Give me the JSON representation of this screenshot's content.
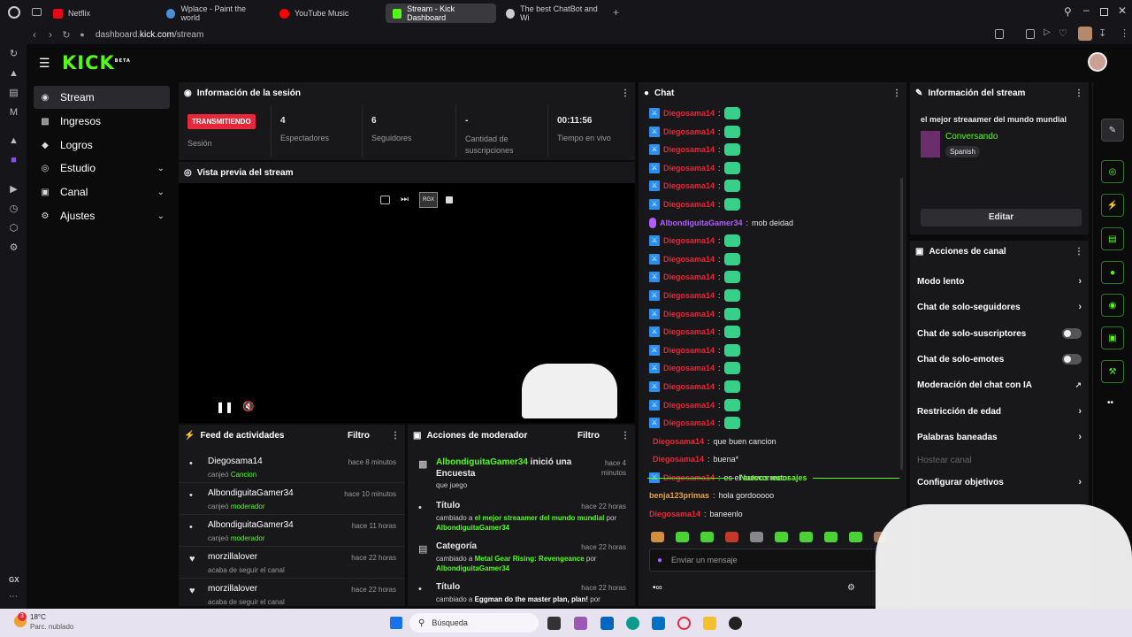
{
  "browser": {
    "tabs": [
      {
        "label": "Netflix",
        "color": "#e50914"
      },
      {
        "label": "Wplace - Paint the world",
        "color": "#4a90d9"
      },
      {
        "label": "YouTube Music",
        "color": "#ff0000"
      },
      {
        "label": "Stream - Kick Dashboard",
        "color": "#53fc18"
      },
      {
        "label": "The best ChatBot and Wi",
        "color": "#cccccc"
      }
    ],
    "url_prefix": "dashboard.",
    "url_domain": "kick.com",
    "url_path": "/stream"
  },
  "app": {
    "logo": "KICK",
    "logo_sup": "BETA"
  },
  "nav": {
    "items": [
      {
        "label": "Stream",
        "icon": "stream-icon"
      },
      {
        "label": "Ingresos",
        "icon": "chart-icon"
      },
      {
        "label": "Logros",
        "icon": "trophy-icon"
      },
      {
        "label": "Estudio",
        "icon": "studio-icon"
      },
      {
        "label": "Canal",
        "icon": "channel-icon"
      },
      {
        "label": "Ajustes",
        "icon": "gear-icon"
      }
    ]
  },
  "session": {
    "title": "Información de la sesión",
    "live_badge": "TRANSMITIENDO",
    "live_label": "Sesión",
    "stats": [
      {
        "value": "4",
        "label": "Espectadores"
      },
      {
        "value": "6",
        "label": "Seguidores"
      },
      {
        "value": "-",
        "label": "Cantidad de suscripciones"
      },
      {
        "value": "00:11:56",
        "label": "Tiempo en vivo"
      }
    ]
  },
  "preview": {
    "title": "Vista previa del stream",
    "rgx": "RGX"
  },
  "feed": {
    "title": "Feed de actividades",
    "filter": "Filtro",
    "items": [
      {
        "user": "Diegosama14",
        "time": "hace 8 minutos",
        "action": "canjeó",
        "target": "Cancion"
      },
      {
        "user": "AlbondiguitaGamer34",
        "time": "hace 10 minutos",
        "action": "canjeó",
        "target": "moderador"
      },
      {
        "user": "AlbondiguitaGamer34",
        "time": "hace 11 horas",
        "action": "canjeó",
        "target": "moderador"
      },
      {
        "user": "morzillalover",
        "time": "hace 22 horas",
        "action": "acaba de seguir el canal",
        "target": ""
      },
      {
        "user": "morzillalover",
        "time": "hace 22 horas",
        "action": "acaba de seguir el canal",
        "target": ""
      }
    ]
  },
  "modactions": {
    "title": "Acciones de moderador",
    "filter": "Filtro",
    "items": [
      {
        "head_user": "AlbondiguitaGamer34",
        "head_rest": " inició una",
        "head2": "Encuesta",
        "time": "hace 4 minutos",
        "line1": "que juego",
        "line1_green": "",
        "line2": ""
      },
      {
        "head_user": "",
        "head_rest": "Título",
        "head2": "",
        "time": "hace 22 horas",
        "line1": "cambiado a ",
        "line1_green": "el mejor streaamer del mundo mundial",
        "line1_after": " por",
        "line2": "AlbondiguitaGamer34"
      },
      {
        "head_user": "",
        "head_rest": "Categoría",
        "head2": "",
        "time": "hace 22 horas",
        "line1": "cambiado a ",
        "line1_green": "Metal Gear Rising: Revengeance",
        "line1_after": " por",
        "line2": "AlbondiguitaGamer34"
      },
      {
        "head_user": "",
        "head_rest": "Título",
        "head2": "",
        "time": "hace 22 horas",
        "line1": "cambiado a ",
        "line1_green": "Eggman do the master plan, plan!",
        "line1_after": " por",
        "line2": ""
      }
    ]
  },
  "chat": {
    "title": "Chat",
    "messages": [
      {
        "user": "Diegosama14",
        "text": "",
        "emote": true,
        "badge": "mod"
      },
      {
        "user": "Diegosama14",
        "text": "",
        "emote": true,
        "badge": "mod"
      },
      {
        "user": "Diegosama14",
        "text": "",
        "emote": true,
        "badge": "mod"
      },
      {
        "user": "Diegosama14",
        "text": "",
        "emote": true,
        "badge": "mod"
      },
      {
        "user": "Diegosama14",
        "text": "",
        "emote": true,
        "badge": "mod"
      },
      {
        "user": "Diegosama14",
        "text": "",
        "emote": true,
        "badge": "mod"
      },
      {
        "user": "AlbondiguitaGamer34",
        "text": "mob deidad",
        "emote": false,
        "badge": "mic"
      },
      {
        "user": "Diegosama14",
        "text": "",
        "emote": true,
        "badge": "mod"
      },
      {
        "user": "Diegosama14",
        "text": "",
        "emote": true,
        "badge": "mod"
      },
      {
        "user": "Diegosama14",
        "text": "",
        "emote": true,
        "badge": "mod"
      },
      {
        "user": "Diegosama14",
        "text": "",
        "emote": true,
        "badge": "mod"
      },
      {
        "user": "Diegosama14",
        "text": "",
        "emote": true,
        "badge": "mod"
      },
      {
        "user": "Diegosama14",
        "text": "",
        "emote": true,
        "badge": "mod"
      },
      {
        "user": "Diegosama14",
        "text": "",
        "emote": true,
        "badge": "mod"
      },
      {
        "user": "Diegosama14",
        "text": "",
        "emote": true,
        "badge": "mod"
      },
      {
        "user": "Diegosama14",
        "text": "",
        "emote": true,
        "badge": "mod"
      },
      {
        "user": "Diegosama14",
        "text": "",
        "emote": true,
        "badge": "mod"
      },
      {
        "user": "Diegosama14",
        "text": "",
        "emote": true,
        "badge": "mod"
      },
      {
        "user": "Diegosama14",
        "text": "que buen cancion",
        "emote": false,
        "badge": "none"
      },
      {
        "user": "Diegosama14",
        "text": "buena*",
        "emote": false,
        "badge": "none"
      },
      {
        "user": "Diegosama14",
        "text": "es el autocorrector",
        "emote": false,
        "badge": "mod"
      }
    ],
    "new_messages": "Nuevos mensajes",
    "after": [
      {
        "user": "benja123primas",
        "text": "hola gordooooo",
        "color": "#e8a33c"
      },
      {
        "user": "Diegosama14",
        "text": "baneenlo",
        "color": "#e5283a"
      }
    ],
    "placeholder": "Enviar un mensaje"
  },
  "streaminfo": {
    "title": "Información del stream",
    "stream_title": "el mejor streaamer del mundo mundial",
    "category": "Conversando",
    "language": "Spanish",
    "edit": "Editar"
  },
  "channel_actions": {
    "title": "Acciones de canal",
    "items": [
      {
        "label": "Modo lento",
        "type": "arrow"
      },
      {
        "label": "Chat de solo-seguidores",
        "type": "arrow"
      },
      {
        "label": "Chat de solo-suscriptores",
        "type": "toggle"
      },
      {
        "label": "Chat de solo-emotes",
        "type": "toggle"
      },
      {
        "label": "Moderación del chat con IA",
        "type": "external"
      },
      {
        "label": "Restricción de edad",
        "type": "arrow"
      },
      {
        "label": "Palabras baneadas",
        "type": "arrow"
      },
      {
        "label": "Hostear canal",
        "type": "disabled"
      },
      {
        "label": "Configurar objetivos",
        "type": "arrow"
      }
    ]
  },
  "taskbar": {
    "weather_temp": "18°C",
    "weather_desc": "Parc. nublado",
    "search": "Búsqueda",
    "badge": "3"
  },
  "sidebar_bottom": "GX"
}
